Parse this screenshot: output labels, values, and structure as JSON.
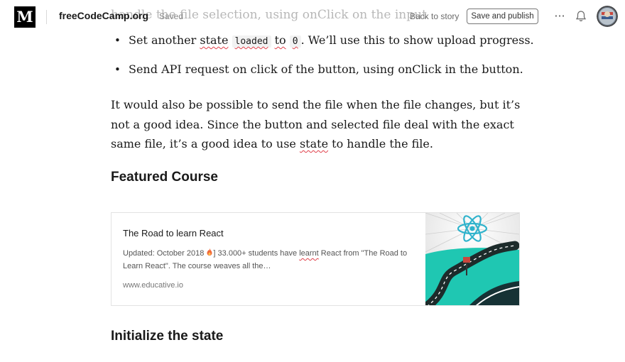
{
  "header": {
    "logo": "M",
    "publication": "freeCodeCamp.org",
    "status": "Saved",
    "back_label": "Back to story",
    "publish_label": "Save and publish",
    "more_label": "···"
  },
  "article": {
    "ghost_text": "handle the file selection, using onClick on the input",
    "bullets": {
      "b1": {
        "pre": "Set another ",
        "word": "state",
        "code1": "loaded",
        "mid": "to",
        "code2": "0",
        "post": ". We’ll use this to show upload progress."
      },
      "b2": {
        "text": "Send API request on click of the button, using onClick in the button."
      }
    },
    "paragraph": {
      "pre": "It would also be possible to send the file when the file changes, but it’s not a good idea. Since the button and selected file deal with the exact same file, it’s a good idea to use ",
      "word": "state",
      "post": " to handle the file."
    },
    "heading_featured": "Featured Course",
    "heading_init": "Initialize the state"
  },
  "embed": {
    "title": "The Road to learn React",
    "desc_pre": "Updated: October 2018 ",
    "desc_mid": "] 33.000+ students have ",
    "desc_word": "learnt",
    "desc_post": " React from \"The Road to Learn React\". The course weaves all the…",
    "url": "www.educative.io",
    "flame_icon": "flame-icon",
    "image_icon": "react-road-illustration"
  },
  "colors": {
    "spellcheck": "#e0404a",
    "road_teal": "#1fc7b2",
    "react_blue": "#3fb8cf"
  }
}
